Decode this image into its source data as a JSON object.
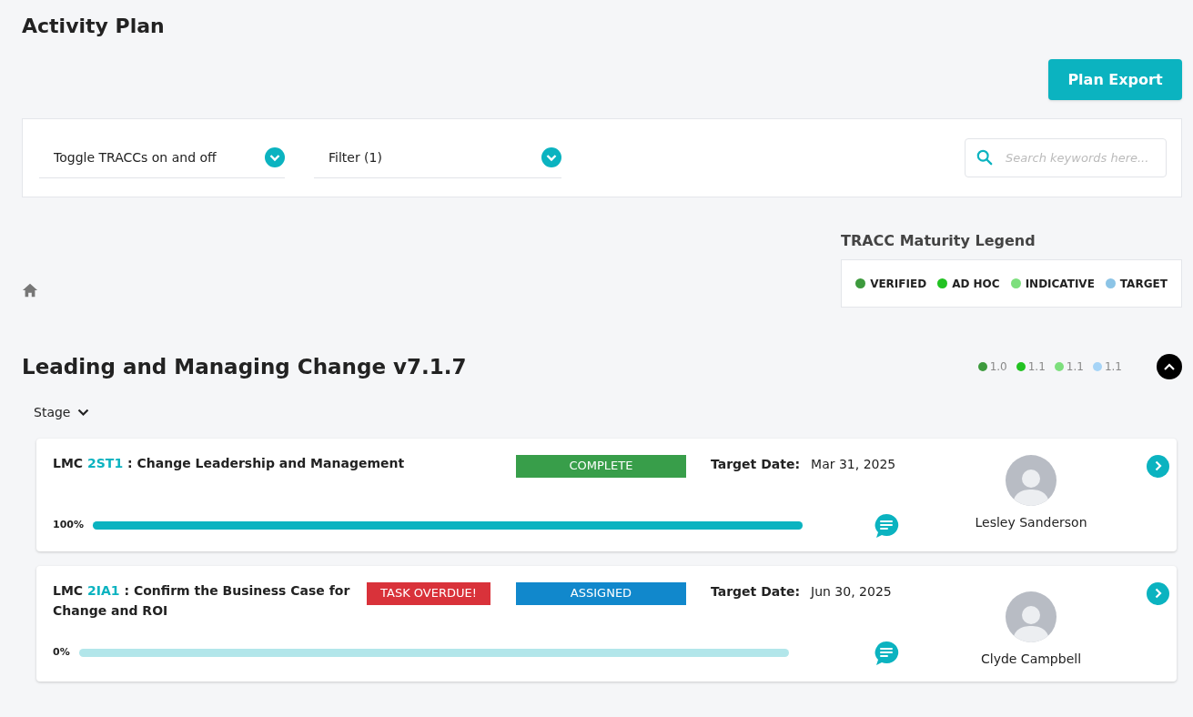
{
  "page_title": "Activity Plan",
  "export_button": "Plan Export",
  "filters": [
    {
      "label": "Toggle TRACCs on and off"
    },
    {
      "label": "Filter (1)"
    }
  ],
  "search": {
    "placeholder": "Search keywords here..."
  },
  "legend": {
    "title": "TRACC Maturity Legend",
    "items": [
      {
        "label": "VERIFIED",
        "color": "#3d9a3d"
      },
      {
        "label": "AD HOC",
        "color": "#22c222"
      },
      {
        "label": "INDICATIVE",
        "color": "#7ddf7d"
      },
      {
        "label": "TARGET",
        "color": "#8cc4e6"
      }
    ]
  },
  "section": {
    "title": "Leading and Managing Change v7.1.7",
    "maturity": [
      {
        "value": "1.0",
        "color": "#3d9a3d"
      },
      {
        "value": "1.1",
        "color": "#22c222"
      },
      {
        "value": "1.1",
        "color": "#7ddf7d"
      },
      {
        "value": "1.1",
        "color": "#a6d4f7"
      }
    ],
    "group_label": "Stage"
  },
  "tasks": [
    {
      "prefix": "LMC",
      "code": "2ST1",
      "title": ": Change Leadership and Management",
      "status": {
        "label": "COMPLETE",
        "color": "#389e4a"
      },
      "target_label": "Target Date:",
      "target_date": "Mar 31, 2025",
      "progress_label": "100%",
      "level": 1.0,
      "assignee": "Lesley Sanderson"
    },
    {
      "prefix": "LMC",
      "code": "2IA1",
      "title": ": Confirm the Business Case for Change and ROI",
      "overdue_label": "TASK OVERDUE!",
      "status": {
        "label": "ASSIGNED",
        "color": "#1188cc"
      },
      "target_label": "Target Date:",
      "target_date": "Jun 30, 2025",
      "progress_label": "0%",
      "level": 0,
      "assignee": "Clyde Campbell"
    }
  ]
}
